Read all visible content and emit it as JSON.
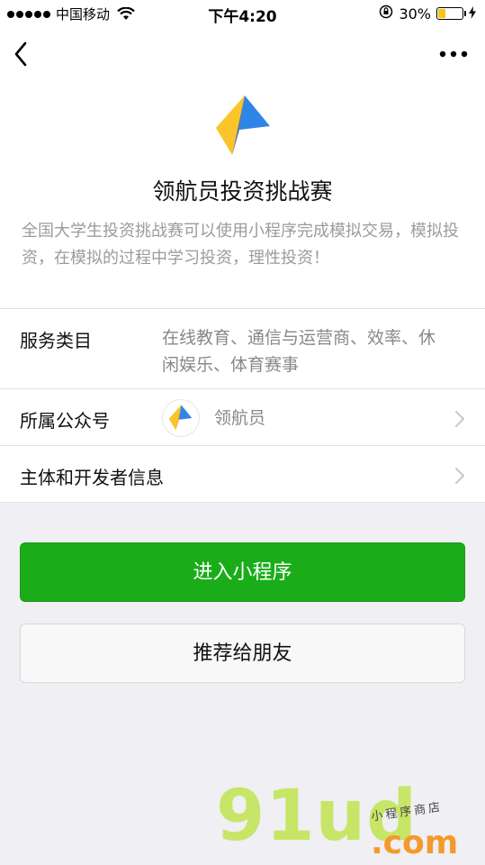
{
  "status_bar": {
    "carrier": "中国移动",
    "time": "下午4:20",
    "battery_percent": "30%",
    "battery_level": 0.3,
    "battery_color": "#f5c518"
  },
  "nav": {
    "back_icon": "chevron-left-icon",
    "more_icon": "more-dots-icon"
  },
  "app": {
    "name": "领航员投资挑战赛",
    "description": "全国大学生投资挑战赛可以使用小程序完成模拟交易，模拟投资，在模拟的过程中学习投资，理性投资！"
  },
  "info_rows": {
    "category_label": "服务类目",
    "category_value": "在线教育、通信与运营商、效率、休闲娱乐、体育赛事",
    "account_label": "所属公众号",
    "account_value": "领航员",
    "developer_label": "主体和开发者信息"
  },
  "buttons": {
    "enter_label": "进入小程序",
    "share_label": "推荐给朋友"
  },
  "watermark": {
    "main": "91ud",
    "suffix": ".com",
    "tagline": "小程序商店"
  },
  "colors": {
    "primary_green": "#1aad19",
    "watermark_green": "#c7e566",
    "watermark_orange": "#f49a2b"
  }
}
